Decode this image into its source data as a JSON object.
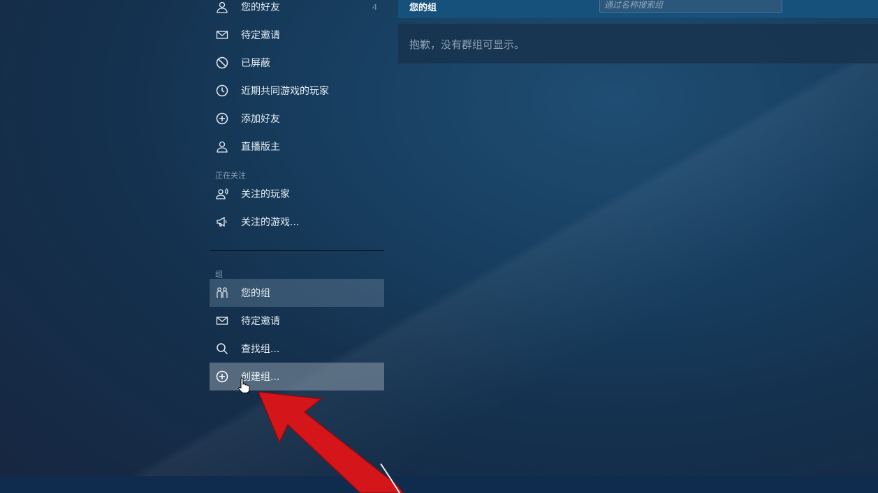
{
  "sidebar": {
    "friends_items": [
      {
        "label": "您的好友",
        "count": "4",
        "icon": "person-icon"
      },
      {
        "label": "待定邀请",
        "icon": "mail-icon"
      },
      {
        "label": "已屏蔽",
        "icon": "blocked-icon"
      },
      {
        "label": "近期共同游戏的玩家",
        "icon": "clock-icon"
      },
      {
        "label": "添加好友",
        "icon": "plus-circle-icon"
      },
      {
        "label": "直播版主",
        "icon": "person-icon"
      }
    ],
    "following_section": "正在关注",
    "following_items": [
      {
        "label": "关注的玩家",
        "icon": "person-broadcast-icon"
      },
      {
        "label": "关注的游戏...",
        "icon": "megaphone-icon"
      }
    ],
    "groups_section": "组",
    "group_items": [
      {
        "label": "您的组",
        "icon": "group-icon"
      },
      {
        "label": "待定邀请",
        "icon": "mail-icon"
      },
      {
        "label": "查找组...",
        "icon": "search-icon"
      },
      {
        "label": "创建组...",
        "icon": "plus-circle-icon"
      }
    ]
  },
  "main": {
    "title": "您的组",
    "search_placeholder": "通过名称搜索组",
    "empty_message": "抱歉，没有群组可显示。"
  },
  "colors": {
    "header": "#16517c",
    "annotation_arrow": "#d4161b",
    "text": "#e6edf3"
  }
}
